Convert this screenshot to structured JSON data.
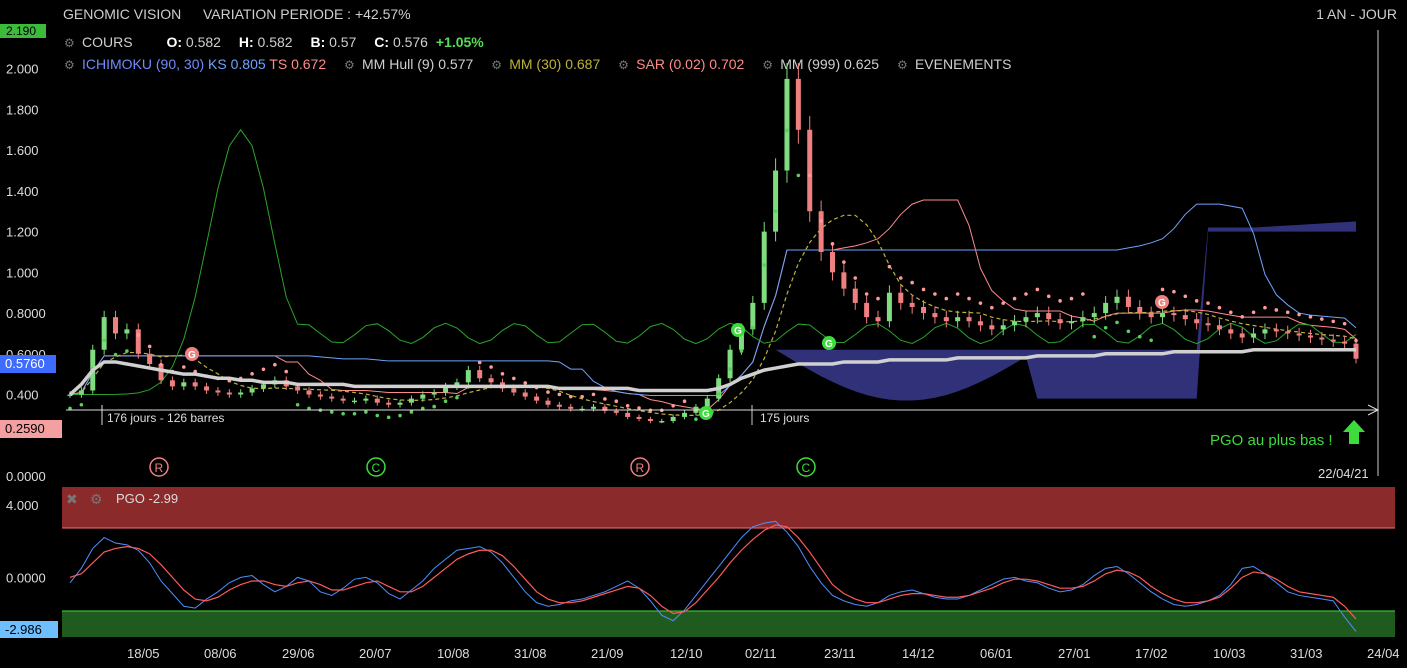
{
  "header": {
    "name": "GENOMIC VISION",
    "variation": "VARIATION PERIODE : +42.57%",
    "range": "1 AN - JOUR"
  },
  "ohlc": {
    "label": "COURS",
    "o_label": "O:",
    "o": "0.582",
    "h_label": "H:",
    "h": "0.582",
    "b_label": "B:",
    "b": "0.57",
    "c_label": "C:",
    "c": "0.576",
    "change": "+1.05%"
  },
  "indicators": {
    "ichimoku": "ICHIMOKU (90, 30)",
    "ks_label": "KS",
    "ks": "0.805",
    "ts_label": "TS",
    "ts": "0.672",
    "hull": "MM Hull (9)",
    "hull_val": "0.577",
    "mm30": "MM (30)",
    "mm30_val": "0.687",
    "sar": "SAR (0.02)",
    "sar_val": "0.702",
    "mm999": "MM (999)",
    "mm999_val": "0.625",
    "events": "EVENEMENTS"
  },
  "colors": {
    "up": "#7fdc7f",
    "down": "#f08080",
    "ichimoku": "#6f8bff",
    "ks": "#6fa3ff",
    "ts": "#ff8a8a",
    "mm30": "#bdb23a",
    "sar": "#ff9a9a",
    "mm999": "#d0d0d0",
    "pgo_up": "#8a2a2a",
    "pgo_down": "#1f5a1f",
    "green_volume": "#2aa52a",
    "badge_last": "#3d6cff"
  },
  "price_axis": {
    "ticks": [
      "2.000",
      "1.800",
      "1.600",
      "1.400",
      "1.200",
      "1.000",
      "0.8000",
      "0.6000",
      "0.400",
      "0.0000"
    ],
    "top_badge": "2.190",
    "last_badge": "0.5760",
    "low_badge": "0.2590"
  },
  "pgo_axis": {
    "ticks": [
      "4.000",
      "0.0000"
    ],
    "last_badge": "-2.986",
    "label": "PGO -2.99"
  },
  "x_axis": {
    "ticks": [
      "18/05",
      "08/06",
      "29/06",
      "20/07",
      "10/08",
      "31/08",
      "21/09",
      "12/10",
      "02/11",
      "23/11",
      "14/12",
      "06/01",
      "27/01",
      "17/02",
      "10/03",
      "31/03",
      "24/04"
    ],
    "last_date": "22/04/21"
  },
  "annotations": {
    "span1": "176 jours - 126 barres",
    "span2": "175 jours",
    "pgo_note": "PGO au plus bas !",
    "markers_bottom": [
      "R",
      "C",
      "R",
      "C"
    ]
  },
  "chart_data": {
    "type": "candlestick",
    "ylabel": "",
    "ylim": [
      0,
      2.19
    ],
    "pgo_ylim": [
      -3.3,
      5.0
    ],
    "close": [
      0.4,
      0.42,
      0.62,
      0.78,
      0.7,
      0.72,
      0.6,
      0.55,
      0.47,
      0.44,
      0.46,
      0.44,
      0.42,
      0.41,
      0.4,
      0.41,
      0.43,
      0.45,
      0.47,
      0.44,
      0.42,
      0.4,
      0.39,
      0.38,
      0.37,
      0.37,
      0.38,
      0.36,
      0.35,
      0.36,
      0.38,
      0.4,
      0.41,
      0.44,
      0.46,
      0.52,
      0.48,
      0.46,
      0.43,
      0.41,
      0.39,
      0.37,
      0.35,
      0.34,
      0.33,
      0.33,
      0.34,
      0.32,
      0.31,
      0.29,
      0.28,
      0.27,
      0.27,
      0.29,
      0.31,
      0.34,
      0.38,
      0.48,
      0.62,
      0.72,
      0.85,
      1.2,
      1.5,
      1.95,
      1.7,
      1.3,
      1.1,
      1.0,
      0.92,
      0.85,
      0.78,
      0.76,
      0.9,
      0.85,
      0.83,
      0.8,
      0.78,
      0.76,
      0.78,
      0.76,
      0.74,
      0.72,
      0.74,
      0.76,
      0.78,
      0.8,
      0.77,
      0.75,
      0.76,
      0.78,
      0.8,
      0.85,
      0.88,
      0.83,
      0.8,
      0.78,
      0.8,
      0.79,
      0.77,
      0.75,
      0.74,
      0.72,
      0.7,
      0.68,
      0.7,
      0.72,
      0.71,
      0.7,
      0.69,
      0.68,
      0.67,
      0.66,
      0.65,
      0.576
    ],
    "pgo": [
      -0.3,
      0.5,
      1.6,
      2.2,
      1.9,
      1.8,
      1.5,
      0.8,
      -0.2,
      -0.9,
      -1.6,
      -1.7,
      -1.2,
      -0.8,
      -0.3,
      0.0,
      0.1,
      -0.4,
      -0.8,
      -0.5,
      0.0,
      -0.2,
      -0.8,
      -1.0,
      -0.6,
      -0.1,
      0.0,
      -0.3,
      -0.9,
      -1.2,
      -0.7,
      -0.2,
      0.5,
      1.0,
      1.5,
      1.6,
      1.7,
      1.4,
      0.8,
      0.0,
      -0.8,
      -1.4,
      -1.6,
      -1.5,
      -1.3,
      -1.2,
      -1.0,
      -0.8,
      -0.5,
      -0.2,
      -0.6,
      -1.3,
      -2.1,
      -2.4,
      -1.8,
      -1.0,
      -0.2,
      0.6,
      1.4,
      2.2,
      2.8,
      3.0,
      3.1,
      2.5,
      1.7,
      0.6,
      -0.3,
      -1.0,
      -1.3,
      -1.5,
      -1.6,
      -1.4,
      -1.0,
      -0.8,
      -0.7,
      -0.9,
      -1.1,
      -1.2,
      -1.2,
      -1.0,
      -0.7,
      -0.4,
      -0.1,
      0.0,
      -0.2,
      -0.3,
      -0.6,
      -0.8,
      -0.7,
      -0.4,
      0.1,
      0.5,
      0.6,
      0.2,
      -0.3,
      -0.8,
      -1.2,
      -1.5,
      -1.6,
      -1.5,
      -1.3,
      -1.0,
      -0.4,
      0.5,
      0.6,
      0.2,
      -0.3,
      -0.8,
      -1.0,
      -1.1,
      -1.2,
      -1.3,
      -2.2,
      -2.99
    ],
    "pgo_signal": [
      0.0,
      0.2,
      0.8,
      1.4,
      1.6,
      1.7,
      1.6,
      1.3,
      0.7,
      0.0,
      -0.7,
      -1.2,
      -1.3,
      -1.1,
      -0.7,
      -0.4,
      -0.2,
      -0.2,
      -0.4,
      -0.5,
      -0.3,
      -0.2,
      -0.4,
      -0.7,
      -0.7,
      -0.5,
      -0.3,
      -0.2,
      -0.5,
      -0.8,
      -0.8,
      -0.5,
      0.0,
      0.5,
      1.0,
      1.3,
      1.5,
      1.5,
      1.2,
      0.6,
      -0.1,
      -0.8,
      -1.2,
      -1.4,
      -1.4,
      -1.3,
      -1.1,
      -0.9,
      -0.7,
      -0.5,
      -0.6,
      -1.0,
      -1.6,
      -2.0,
      -1.9,
      -1.4,
      -0.7,
      0.0,
      0.8,
      1.5,
      2.1,
      2.6,
      2.9,
      2.8,
      2.2,
      1.4,
      0.5,
      -0.4,
      -0.9,
      -1.2,
      -1.4,
      -1.4,
      -1.2,
      -1.0,
      -0.9,
      -0.9,
      -1.0,
      -1.1,
      -1.1,
      -1.0,
      -0.8,
      -0.6,
      -0.3,
      -0.1,
      -0.1,
      -0.2,
      -0.4,
      -0.6,
      -0.6,
      -0.5,
      -0.2,
      0.2,
      0.4,
      0.3,
      0.0,
      -0.5,
      -0.9,
      -1.2,
      -1.4,
      -1.4,
      -1.3,
      -1.1,
      -0.6,
      0.0,
      0.3,
      0.2,
      -0.1,
      -0.5,
      -0.8,
      -0.9,
      -1.0,
      -1.1,
      -1.6,
      -2.3
    ],
    "mm999": [
      0.4,
      0.45,
      0.52,
      0.56,
      0.56,
      0.55,
      0.54,
      0.53,
      0.52,
      0.51,
      0.5,
      0.5,
      0.49,
      0.48,
      0.48,
      0.47,
      0.47,
      0.46,
      0.46,
      0.46,
      0.45,
      0.45,
      0.45,
      0.45,
      0.45,
      0.44,
      0.44,
      0.44,
      0.44,
      0.44,
      0.44,
      0.44,
      0.44,
      0.44,
      0.44,
      0.44,
      0.44,
      0.44,
      0.44,
      0.44,
      0.44,
      0.44,
      0.44,
      0.43,
      0.43,
      0.43,
      0.43,
      0.43,
      0.43,
      0.43,
      0.42,
      0.42,
      0.42,
      0.42,
      0.42,
      0.42,
      0.42,
      0.43,
      0.45,
      0.48,
      0.5,
      0.52,
      0.53,
      0.54,
      0.55,
      0.55,
      0.55,
      0.55,
      0.56,
      0.56,
      0.56,
      0.56,
      0.57,
      0.57,
      0.57,
      0.57,
      0.57,
      0.57,
      0.58,
      0.58,
      0.58,
      0.58,
      0.58,
      0.58,
      0.58,
      0.59,
      0.59,
      0.59,
      0.59,
      0.59,
      0.59,
      0.6,
      0.6,
      0.6,
      0.6,
      0.6,
      0.6,
      0.61,
      0.61,
      0.61,
      0.61,
      0.61,
      0.61,
      0.61,
      0.62,
      0.62,
      0.62,
      0.62,
      0.62,
      0.62,
      0.62,
      0.62,
      0.62,
      0.62
    ]
  }
}
